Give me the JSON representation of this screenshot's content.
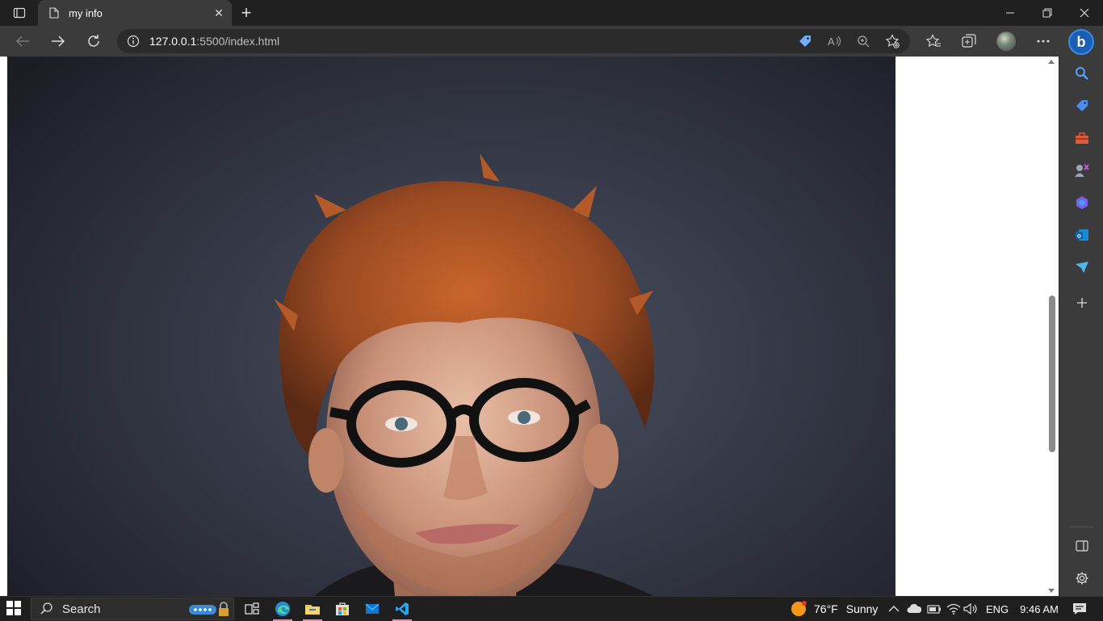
{
  "browser": {
    "tab": {
      "title": "my info"
    },
    "address": {
      "host": "127.0.0.1",
      "rest": ":5500/index.html"
    }
  },
  "taskbar": {
    "search_label": "Search",
    "weather": {
      "temp": "76°F",
      "condition": "Sunny"
    },
    "language": "ENG",
    "time": "9:46 AM"
  }
}
